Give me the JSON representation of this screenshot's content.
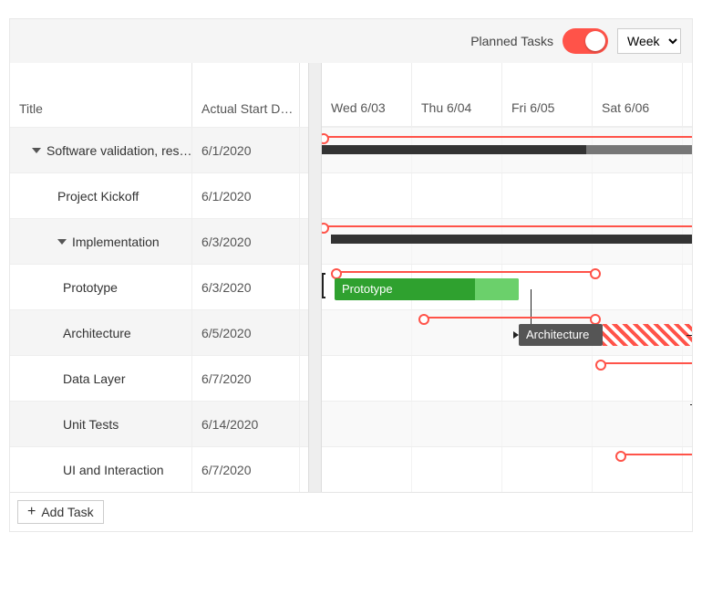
{
  "toolbar": {
    "planned_label": "Planned Tasks",
    "planned_on": true,
    "view_value": "Week"
  },
  "columns": {
    "title": "Title",
    "start": "Actual Start D…"
  },
  "timeline": {
    "unit": "day",
    "days": [
      "Wed 6/03",
      "Thu 6/04",
      "Fri 6/05",
      "Sat 6/06"
    ]
  },
  "tasks": [
    {
      "title": "Software validation, res…",
      "start": "6/1/2020",
      "level": 0,
      "collapsible": true
    },
    {
      "title": "Project Kickoff",
      "start": "6/1/2020",
      "level": 1,
      "collapsible": false
    },
    {
      "title": "Implementation",
      "start": "6/3/2020",
      "level": 1,
      "collapsible": true
    },
    {
      "title": "Prototype",
      "start": "6/3/2020",
      "level": 2,
      "collapsible": false
    },
    {
      "title": "Architecture",
      "start": "6/5/2020",
      "level": 2,
      "collapsible": false
    },
    {
      "title": "Data Layer",
      "start": "6/7/2020",
      "level": 2,
      "collapsible": false
    },
    {
      "title": "Unit Tests",
      "start": "6/14/2020",
      "level": 2,
      "collapsible": false
    },
    {
      "title": "UI and Interaction",
      "start": "6/7/2020",
      "level": 2,
      "collapsible": false
    }
  ],
  "bars": {
    "prototype_label": "Prototype",
    "architecture_label": "Architecture"
  },
  "footer": {
    "add_label": "Add Task"
  },
  "colors": {
    "accent": "#ff5349",
    "task_done": "#2fa12f",
    "summary": "#333333"
  }
}
